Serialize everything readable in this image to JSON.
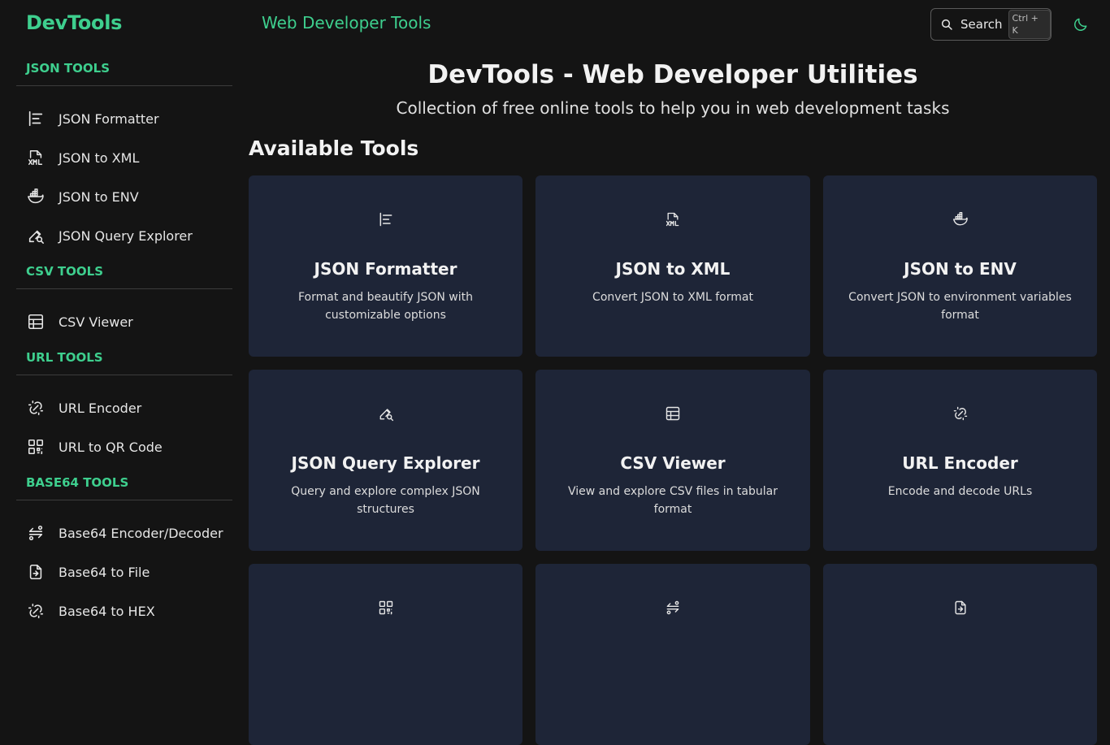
{
  "header": {
    "logo": "DevTools",
    "title": "Web Developer Tools",
    "search_label": "Search",
    "search_shortcut": "Ctrl + K"
  },
  "sidebar": {
    "sections": [
      {
        "title": "JSON TOOLS",
        "items": [
          {
            "label": "JSON Formatter",
            "icon": "align-left-icon"
          },
          {
            "label": "JSON to XML",
            "icon": "xml-file-icon"
          },
          {
            "label": "JSON to ENV",
            "icon": "docker-icon"
          },
          {
            "label": "JSON Query Explorer",
            "icon": "pen-search-icon"
          }
        ]
      },
      {
        "title": "CSV TOOLS",
        "items": [
          {
            "label": "CSV Viewer",
            "icon": "table-icon"
          }
        ]
      },
      {
        "title": "URL TOOLS",
        "items": [
          {
            "label": "URL Encoder",
            "icon": "link-off-icon"
          },
          {
            "label": "URL to QR Code",
            "icon": "qr-code-icon"
          }
        ]
      },
      {
        "title": "BASE64 TOOLS",
        "items": [
          {
            "label": "Base64 Encoder/Decoder",
            "icon": "swap-icon"
          },
          {
            "label": "Base64 to File",
            "icon": "file-arrow-icon"
          },
          {
            "label": "Base64 to HEX",
            "icon": "link-off-icon"
          }
        ]
      }
    ]
  },
  "main": {
    "title": "DevTools - Web Developer Utilities",
    "subtitle": "Collection of free online tools to help you in web development tasks",
    "section_title": "Available Tools",
    "cards": [
      {
        "title": "JSON Formatter",
        "desc": "Format and beautify JSON with customizable options",
        "icon": "align-left-icon"
      },
      {
        "title": "JSON to XML",
        "desc": "Convert JSON to XML format",
        "icon": "xml-file-icon"
      },
      {
        "title": "JSON to ENV",
        "desc": "Convert JSON to environment variables format",
        "icon": "docker-icon"
      },
      {
        "title": "JSON Query Explorer",
        "desc": "Query and explore complex JSON structures",
        "icon": "pen-search-icon"
      },
      {
        "title": "CSV Viewer",
        "desc": "View and explore CSV files in tabular format",
        "icon": "table-icon"
      },
      {
        "title": "URL Encoder",
        "desc": "Encode and decode URLs",
        "icon": "link-off-icon"
      },
      {
        "title": "",
        "desc": "",
        "icon": "qr-code-icon"
      },
      {
        "title": "",
        "desc": "",
        "icon": "swap-icon"
      },
      {
        "title": "",
        "desc": "",
        "icon": "file-arrow-icon"
      }
    ]
  },
  "colors": {
    "accent": "#3ecf8e",
    "background": "#141414",
    "card": "#1e2537"
  }
}
